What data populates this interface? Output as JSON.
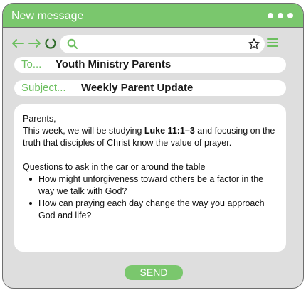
{
  "window": {
    "title": "New message"
  },
  "colors": {
    "accent": "#7ac76d",
    "window_bg": "#dedede",
    "field_label": "#6cbf5f"
  },
  "toolbar": {
    "icons": [
      "arrow-left-icon",
      "arrow-right-icon",
      "refresh-icon",
      "search-icon",
      "star-icon",
      "hamburger-menu-icon"
    ],
    "url": ""
  },
  "to": {
    "label": "To...",
    "value": "Youth Ministry Parents"
  },
  "subject": {
    "label": "Subject...",
    "value": "Weekly Parent Update"
  },
  "message": {
    "greeting": "Parents,",
    "line_prefix": "This week, we will be studying ",
    "scripture": "Luke 11:1–3",
    "line_suffix": " and focusing on the truth that disciples of Christ know the value of prayer.",
    "questions_heading": "Questions to ask in the car or around the table",
    "questions": [
      "How might unforgiveness toward others be a factor in the way we talk with God?",
      "How can praying each day change the way you approach God and life?"
    ]
  },
  "send_label": "SEND"
}
